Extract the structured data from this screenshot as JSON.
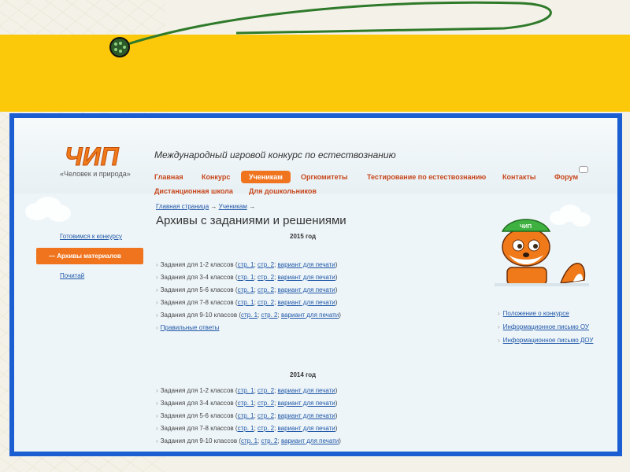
{
  "colors": {
    "slide_yellow": "#fbc80a",
    "frame_blue": "#1a5ed1",
    "accent_orange": "#f0741e",
    "link_blue": "#1f57a8"
  },
  "site": {
    "logo_text": "ЧИП",
    "logo_subtitle": "«Человек и природа»",
    "title": "Международный игровой конкурс по естествознанию"
  },
  "nav": {
    "row1": [
      "Главная",
      "Конкурс",
      "Ученикам",
      "Оргкомитеты",
      "Тестирование по естествознанию",
      "Контакты",
      "Форум"
    ],
    "row2": [
      "Дистанционная школа",
      "Для дошкольников"
    ],
    "active": "Ученикам"
  },
  "sidebar": {
    "items": [
      {
        "label": "Готовимся к конкурсу"
      },
      {
        "label": "— Архивы материалов"
      },
      {
        "label": "Почитай"
      }
    ]
  },
  "breadcrumb": {
    "home": "Главная страница",
    "section": "Ученикам",
    "sep": "→"
  },
  "page_title": "Архивы с заданиями и решениями",
  "link_texts": {
    "page1": "стр. 1",
    "page2": "стр. 2",
    "print": "вариант для печати"
  },
  "years": [
    {
      "year": "2015 год",
      "tasks": [
        "Задания для 1-2 классов",
        "Задания для 3-4 классов",
        "Задания для 5-6 классов",
        "Задания для 7-8 классов",
        "Задания для 9-10 классов"
      ],
      "answers": "Правильные ответы"
    },
    {
      "year": "2014 год",
      "tasks": [
        "Задания для 1-2 классов",
        "Задания для 3-4 классов",
        "Задания для 5-6 классов",
        "Задания для 7-8 классов",
        "Задания для 9-10 классов"
      ]
    }
  ],
  "right_links": [
    "Положение о конкурсе",
    "Информационное письмо ОУ",
    "Информационное письмо ДОУ"
  ],
  "icons": {
    "arrow": "›",
    "cap_label": "ЧИП"
  }
}
